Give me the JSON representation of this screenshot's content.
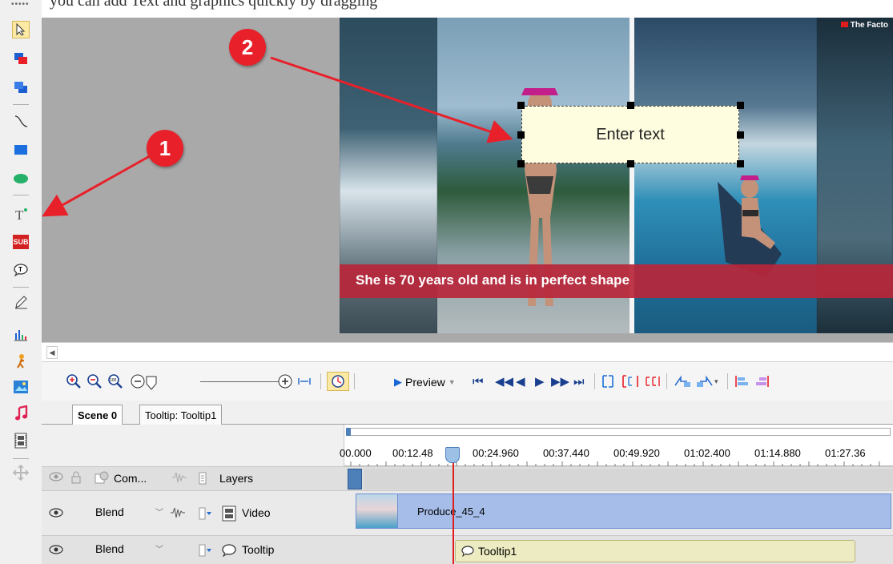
{
  "top_caption": "you can add Text and graphics quickly by dragging",
  "video": {
    "caption": "She is 70 years old and is in perfect shape",
    "brand": "The Facto",
    "textbox_text": "Enter text"
  },
  "callouts": [
    "1",
    "2"
  ],
  "left_tools": [
    "select-arrow-icon",
    "bring-forward-icon",
    "send-backward-icon",
    "line-icon",
    "rectangle-icon",
    "ellipse-icon",
    "text-icon",
    "subtitle-icon",
    "tooltip-icon",
    "pen-icon",
    "chart-icon",
    "character-icon",
    "image-icon",
    "audio-icon",
    "video-icon",
    "move-icon"
  ],
  "subtitle_label": "SUB",
  "timeline_toolbar": {
    "preview_label": "Preview"
  },
  "tabs": [
    {
      "label": "Scene 0"
    },
    {
      "label": "Tooltip: Tooltip1"
    }
  ],
  "ruler": {
    "ticks": [
      "00.000",
      "00:12.48",
      "00:24.960",
      "00:37.440",
      "00:49.920",
      "01:02.400",
      "01:14.880",
      "01:27.36"
    ]
  },
  "layers_header": {
    "com_label": "Com...",
    "layers_label": "Layers"
  },
  "tracks": [
    {
      "blend": "Blend",
      "name": "Video",
      "clip": "Produce_45_4"
    },
    {
      "blend": "Blend",
      "name": "Tooltip",
      "clip": "Tooltip1"
    }
  ],
  "colors": {
    "accent_red": "#e8202a",
    "caption_bar": "#b8263a",
    "video_clip": "#a5bde8",
    "tooltip_clip": "#ecebc1"
  }
}
